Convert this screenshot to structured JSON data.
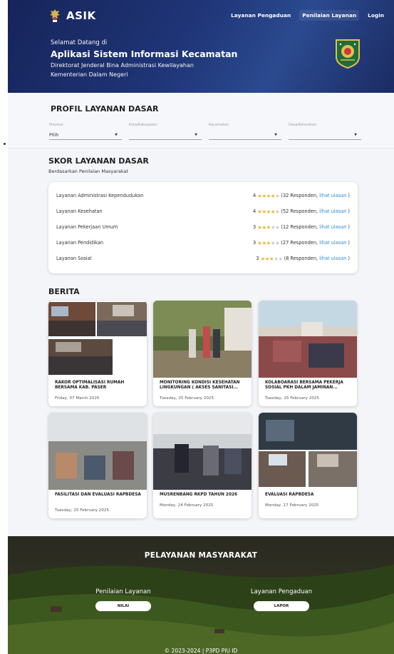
{
  "header": {
    "brand": "ASIK",
    "nav": [
      "Layanan Pengaduan",
      "Penilaian Layanan",
      "Login"
    ],
    "welcome_line1": "Selamat Datang di",
    "welcome_line2": "Aplikasi Sistem Informasi Kecamatan",
    "welcome_line3": "Direktorat Jenderal Bina Administrasi Kewilayahan",
    "welcome_line4": "Kementerian Dalam Negeri"
  },
  "profil": {
    "title": "PROFIL LAYANAN DASAR",
    "filters": [
      {
        "label": "Provinsi",
        "value": "Pilih"
      },
      {
        "label": "Kota/Kabupaten",
        "value": ""
      },
      {
        "label": "Kecamatan",
        "value": ""
      },
      {
        "label": "Desa/Kelurahan",
        "value": ""
      }
    ]
  },
  "skor": {
    "title": "SKOR LAYANAN DASAR",
    "subtitle": "Berdasarkan Penilaian Masyarakat",
    "rows": [
      {
        "name": "Layanan Administrasi Kependudukan",
        "score": "4",
        "rating": 4,
        "responses": "(32 Responden,",
        "link": "lihat ulasan",
        "close": ")"
      },
      {
        "name": "Layanan Kesehatan",
        "score": "4",
        "rating": 4,
        "responses": "(52 Responden,",
        "link": "lihat ulasan",
        "close": ")"
      },
      {
        "name": "Layanan Pekerjaan Umum",
        "score": "3",
        "rating": 3,
        "responses": "(12 Responden,",
        "link": "lihat ulasan",
        "close": ")"
      },
      {
        "name": "Layanan Pendidikan",
        "score": "3",
        "rating": 3,
        "responses": "(27 Responden,",
        "link": "lihat ulasan",
        "close": ")"
      },
      {
        "name": "Layanan Sosial",
        "score": "3",
        "rating": 3,
        "responses": "(8 Responden,",
        "link": "lihat ulasan",
        "close": ")"
      }
    ]
  },
  "berita": {
    "title": "BERITA",
    "items": [
      {
        "title": "RAKOR OPTIMALISASI RUMAH BERSAMA KAB. PASER",
        "date": "Friday, 07 March 2025"
      },
      {
        "title": "MONITORING KONDISI KESEHATAN LINGKUNGAN ( AKSES SANITASI...",
        "date": "Tuesday, 25 February 2025"
      },
      {
        "title": "KOLABOARASI BERSAMA PEKERJA SOSIAL PKH DALAM JAMINAN...",
        "date": "Tuesday, 25 February 2025"
      },
      {
        "title": "FASILITASI DAN EVALUASI RAPBDESA",
        "date": "Tuesday, 25 February 2025"
      },
      {
        "title": "MUSRENBANG RKPD TAHUN 2026",
        "date": "Monday, 24 February 2025"
      },
      {
        "title": "EVALUASI RAPBDESA",
        "date": "Monday, 17 February 2025"
      }
    ]
  },
  "footer": {
    "title": "PELAYANAN MASYARAKAT",
    "services": [
      {
        "label": "Penilaian Layanan",
        "button": "NILAI"
      },
      {
        "label": "Layanan Pengaduan",
        "button": "LAPOR"
      }
    ],
    "copyright": "© 2023-2024 | P3PD PIU ID"
  },
  "colors": {
    "header": "#1f3577",
    "star": "#f3b531",
    "link": "#2f8fd8"
  }
}
